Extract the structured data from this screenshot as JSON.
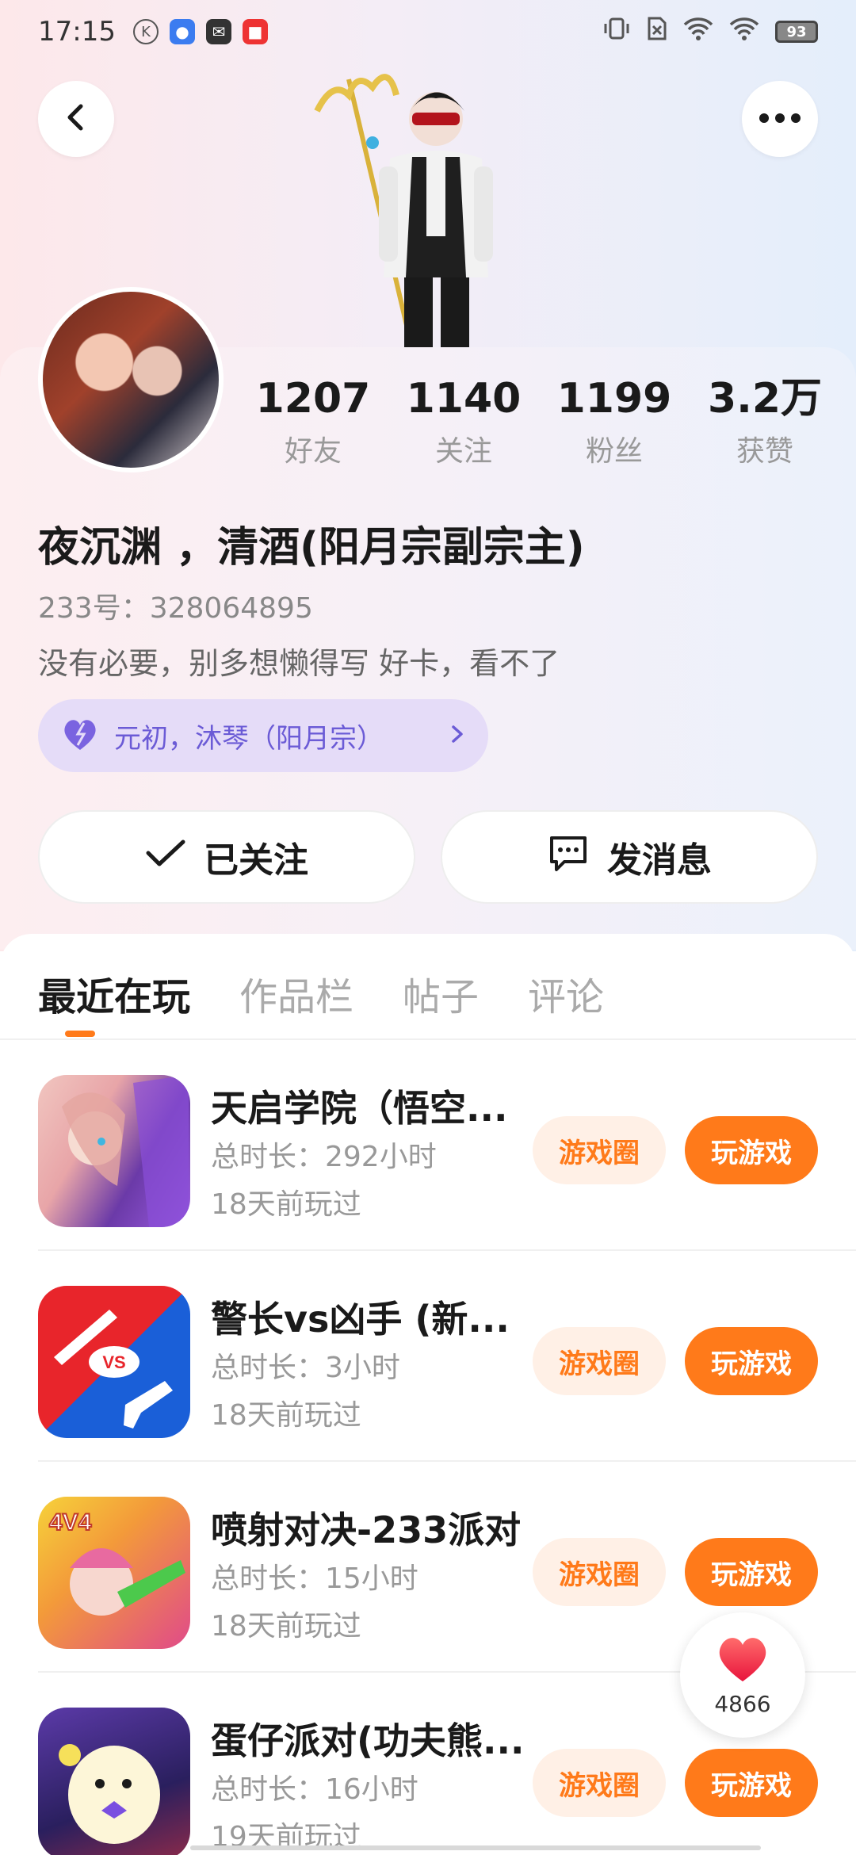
{
  "status_bar": {
    "time": "17:15",
    "battery": "93"
  },
  "profile": {
    "stats": [
      {
        "value": "1207",
        "label": "好友"
      },
      {
        "value": "1140",
        "label": "关注"
      },
      {
        "value": "1199",
        "label": "粉丝"
      },
      {
        "value": "3.2万",
        "label": "获赞"
      }
    ],
    "nickname": "夜沉渊 ，清酒(阳月宗副宗主)",
    "user_id": "233号：328064895",
    "bio": "没有必要，别多想懒得写    好卡，看不了",
    "cp_label": "元初，沐琴（阳月宗）"
  },
  "actions": {
    "follow_label": "已关注",
    "message_label": "发消息"
  },
  "tabs": [
    {
      "label": "最近在玩",
      "active": true
    },
    {
      "label": "作品栏",
      "active": false
    },
    {
      "label": "帖子",
      "active": false
    },
    {
      "label": "评论",
      "active": false
    }
  ],
  "games": [
    {
      "title": "天启学院（悟空...",
      "duration": "总时长：292小时",
      "last_played": "18天前玩过",
      "circle_label": "游戏圈",
      "play_label": "玩游戏"
    },
    {
      "title": "警长vs凶手 (新...",
      "duration": "总时长：3小时",
      "last_played": "18天前玩过",
      "circle_label": "游戏圈",
      "play_label": "玩游戏"
    },
    {
      "title": "喷射对决-233派对",
      "duration": "总时长：15小时",
      "last_played": "18天前玩过",
      "circle_label": "游戏圈",
      "play_label": "玩游戏"
    },
    {
      "title": "蛋仔派对(功夫熊...",
      "duration": "总时长：16小时",
      "last_played": "19天前玩过",
      "circle_label": "游戏圈",
      "play_label": "玩游戏"
    }
  ],
  "like_float": {
    "count": "4866"
  },
  "colors": {
    "accent": "#ff7a1a",
    "accent_soft": "#fff0e6",
    "cp_pill": "#e5dcf8",
    "cp_text": "#6b5bd6"
  },
  "icons": {
    "back": "chevron-left-icon",
    "more": "more-dots-icon",
    "check": "check-icon",
    "message": "message-bubble-icon",
    "heart": "heart-icon",
    "arrow": "chevron-right-icon"
  },
  "game_icon_text": {
    "sheriff_badge": "VS",
    "jet_badge": "4V4"
  }
}
